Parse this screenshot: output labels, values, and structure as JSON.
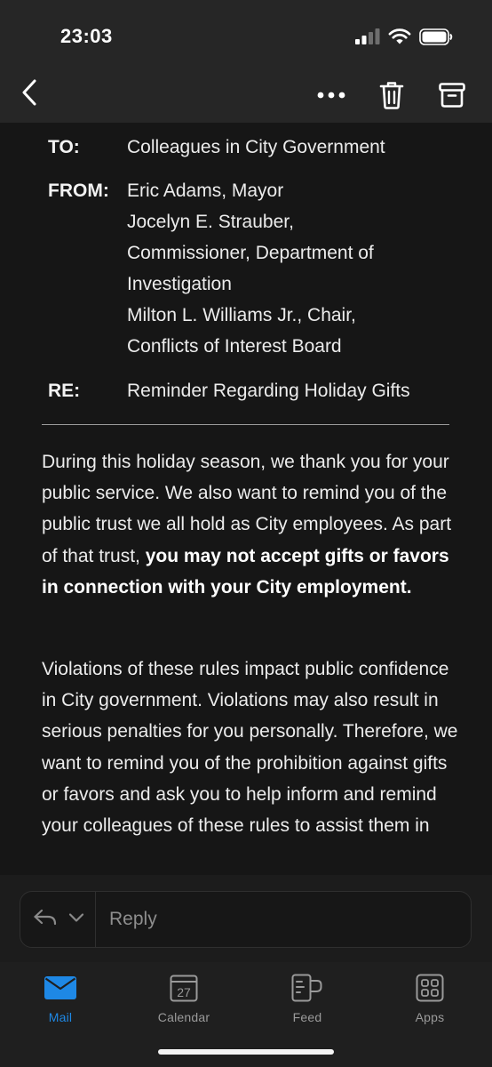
{
  "status_bar": {
    "time": "23:03"
  },
  "icons": {
    "back": "chevron-left-icon",
    "more": "more-horizontal-icon",
    "delete": "trash-icon",
    "archive": "archive-icon",
    "reply": "reply-arrow-icon",
    "reply_options": "chevron-down-icon"
  },
  "memo": {
    "to_label": "TO:",
    "to_value": "Colleagues in City Government",
    "from_label": "FROM:",
    "from_lines": [
      "Eric Adams, Mayor",
      "Jocelyn E. Strauber,",
      "Commissioner, Department of",
      "Investigation",
      "Milton L. Williams Jr., Chair,",
      "Conflicts of Interest Board"
    ],
    "re_label": "RE:",
    "re_value": "Reminder Regarding Holiday Gifts"
  },
  "body": {
    "p1_text": "During this holiday season, we thank you for your public service. We also want to remind you of the public trust we all hold as City employees. As part of that trust, ",
    "p1_bold": "you may not accept gifts or favors in connection with your City employment.",
    "p2_text": "Violations of these rules impact public confidence in City government. Violations may also result in serious penalties for you personally. Therefore, we want to remind you of the prohibition against gifts or favors and ask you to help inform and remind your colleagues of these rules to assist them in"
  },
  "reply": {
    "placeholder": "Reply"
  },
  "tabs": [
    {
      "label": "Mail",
      "active": true
    },
    {
      "label": "Calendar",
      "active": false,
      "badge": "27"
    },
    {
      "label": "Feed",
      "active": false
    },
    {
      "label": "Apps",
      "active": false
    }
  ],
  "colors": {
    "accent": "#1e88e5",
    "background": "#161616",
    "header": "#262626"
  }
}
